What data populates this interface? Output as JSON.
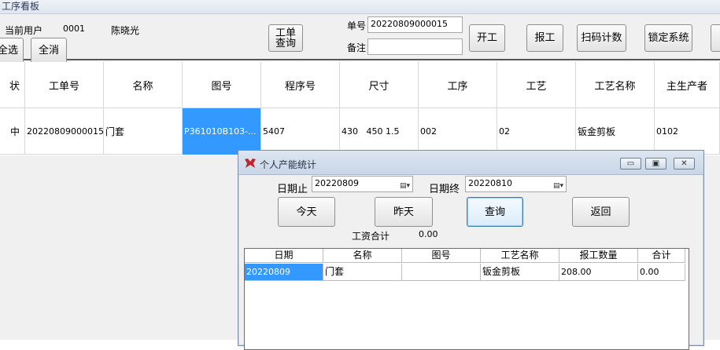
{
  "window": {
    "title": "工序看板"
  },
  "toolbar": {
    "current_user_label": "当前用户",
    "user_id": "0001",
    "user_name": "陈晓光",
    "select_all": "全选",
    "deselect_all": "全消",
    "work_order_query": "工单查询",
    "order_no_label": "单号",
    "order_no_value": "20220809000015",
    "remark_label": "备注",
    "remark_value": "",
    "start_button": "开工",
    "report_button": "报工",
    "scan_count_button": "扫码计数",
    "lock_button": "锁定系统"
  },
  "grid": {
    "columns": [
      "状",
      "工单号",
      "名称",
      "图号",
      "程序号",
      "尺寸",
      "工序",
      "工艺",
      "工艺名称",
      "主生产者"
    ],
    "row": [
      "中",
      "20220809000015",
      "门套",
      "P361010B103-...",
      "5407",
      "430   450 1.5",
      "002",
      "02",
      "钣金剪板",
      "0102"
    ]
  },
  "dialog": {
    "title": "个人产能统计",
    "date_from_label": "日期止",
    "date_from_value": "20220809",
    "date_to_label": "日期终",
    "date_to_value": "20220810",
    "today_button": "今天",
    "yesterday_button": "昨天",
    "query_button": "查询",
    "back_button": "返回",
    "wage_total_label": "工资合计",
    "wage_total_value": "0.00",
    "minimize_glyph": "▭",
    "restore_glyph": "▣",
    "close_glyph": "✕",
    "table": {
      "columns": [
        "日期",
        "名称",
        "图号",
        "工艺名称",
        "报工数量",
        "合计"
      ],
      "row": [
        "20220809",
        "门套",
        "",
        "钣金剪板",
        "208.00",
        "0.00"
      ]
    }
  },
  "colors": {
    "selection": "#3399ff",
    "app_icon": "#c0262d"
  }
}
